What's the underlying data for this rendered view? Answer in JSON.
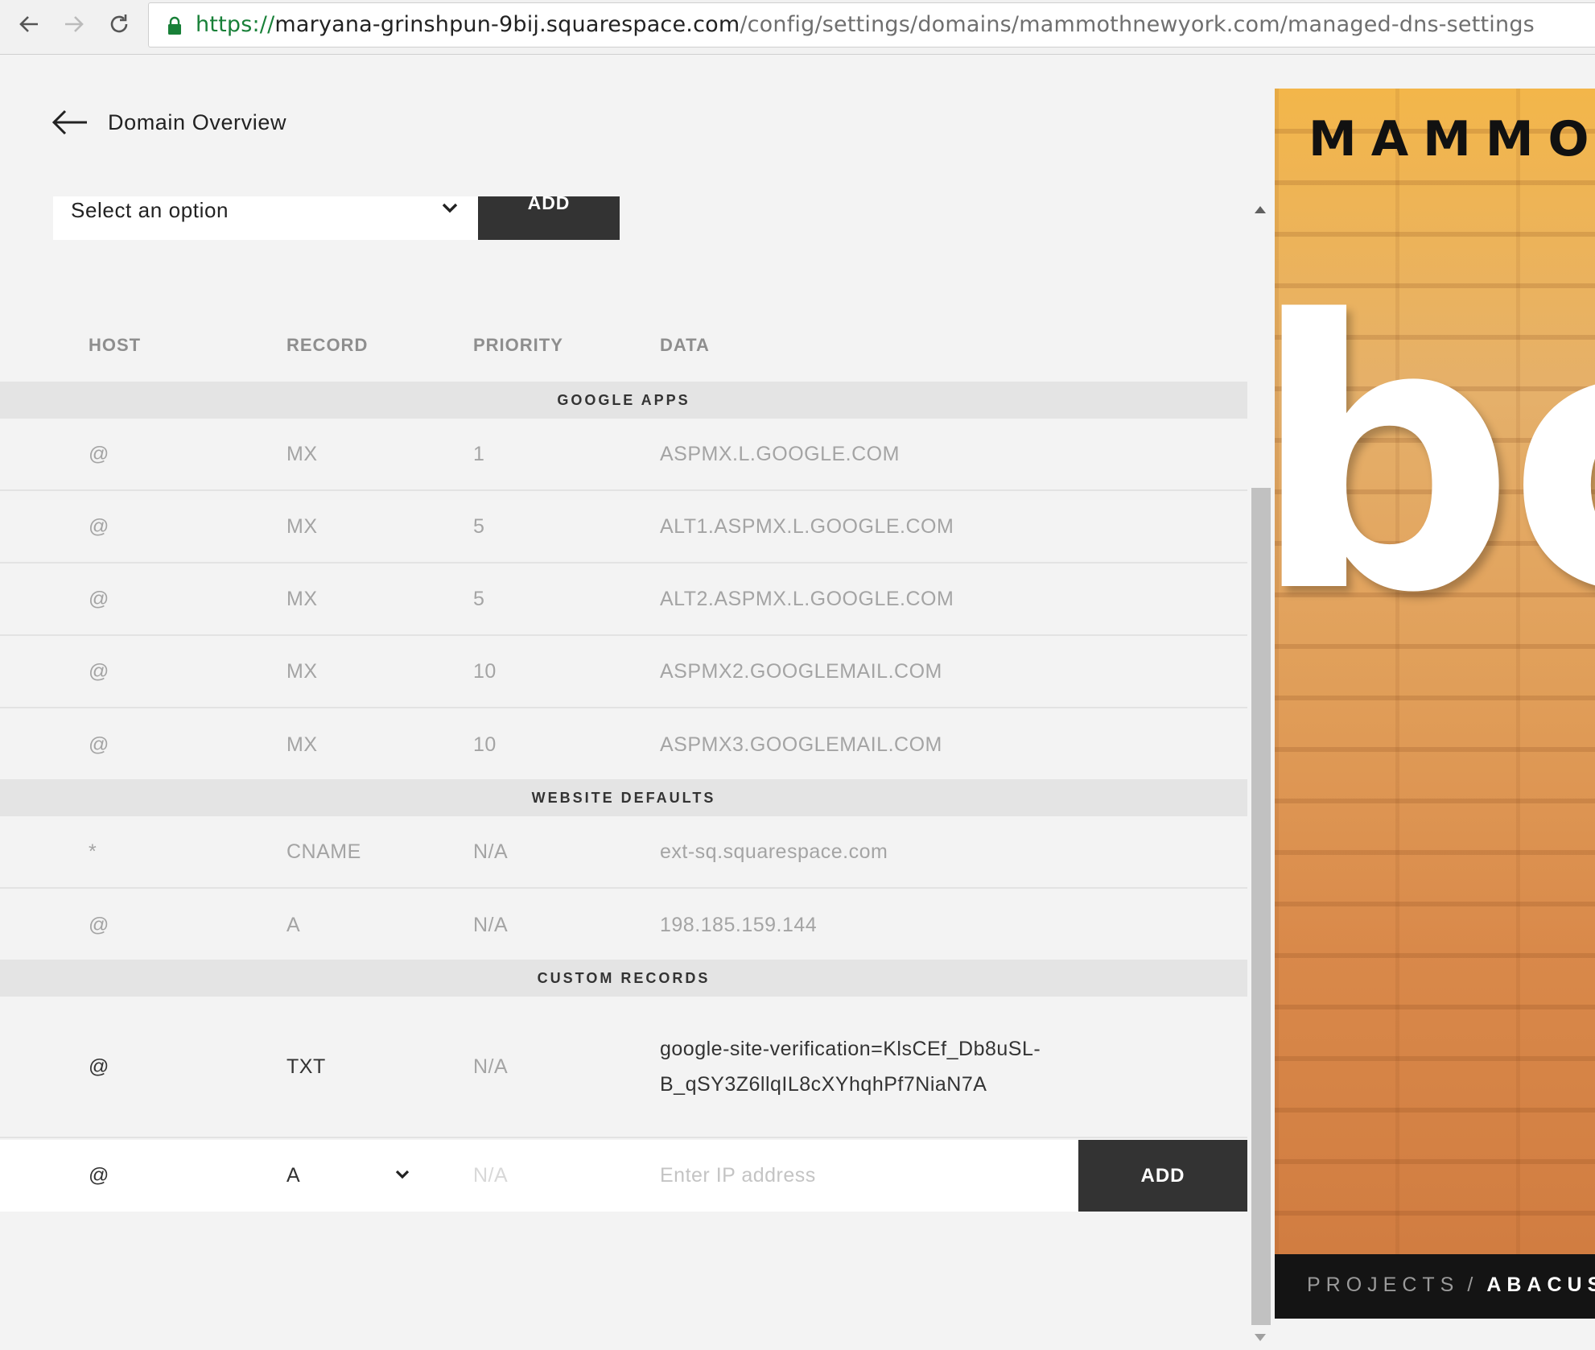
{
  "browser": {
    "url_scheme": "https://",
    "url_host": "maryana-grinshpun-9bij.squarespace.com",
    "url_path": "/config/settings/domains/mammothnewyork.com/managed-dns-settings"
  },
  "header": {
    "back_label": "Domain Overview"
  },
  "preset": {
    "select_value": "Select an option",
    "add_label": "ADD"
  },
  "columns": {
    "host": "HOST",
    "record": "RECORD",
    "priority": "PRIORITY",
    "data": "DATA"
  },
  "sections": {
    "google_apps": {
      "title": "GOOGLE APPS",
      "rows": [
        {
          "host": "@",
          "record": "MX",
          "priority": "1",
          "data": "ASPMX.L.GOOGLE.COM"
        },
        {
          "host": "@",
          "record": "MX",
          "priority": "5",
          "data": "ALT1.ASPMX.L.GOOGLE.COM"
        },
        {
          "host": "@",
          "record": "MX",
          "priority": "5",
          "data": "ALT2.ASPMX.L.GOOGLE.COM"
        },
        {
          "host": "@",
          "record": "MX",
          "priority": "10",
          "data": "ASPMX2.GOOGLEMAIL.COM"
        },
        {
          "host": "@",
          "record": "MX",
          "priority": "10",
          "data": "ASPMX3.GOOGLEMAIL.COM"
        }
      ]
    },
    "website_defaults": {
      "title": "WEBSITE DEFAULTS",
      "rows": [
        {
          "host": "*",
          "record": "CNAME",
          "priority": "N/A",
          "data": "ext-sq.squarespace.com"
        },
        {
          "host": "@",
          "record": "A",
          "priority": "N/A",
          "data": "198.185.159.144"
        }
      ]
    },
    "custom_records": {
      "title": "CUSTOM RECORDS",
      "rows": [
        {
          "host": "@",
          "record": "TXT",
          "priority": "N/A",
          "data": "google-site-verification=KlsCEf_Db8uSL-B_qSY3Z6llqIL8cXYhqhPf7NiaN7A"
        }
      ]
    }
  },
  "new_record": {
    "host": "@",
    "record": "A",
    "priority": "N/A",
    "data_placeholder": "Enter IP address",
    "add_label": "ADD"
  },
  "preview": {
    "brand": "MAMMOT",
    "big_text": "bc",
    "breadcrumb_parent": "PROJECTS",
    "breadcrumb_sep": "/",
    "breadcrumb_current": "ABACUS"
  },
  "colors": {
    "button_dark": "#333333",
    "url_secure": "#188038",
    "muted_text": "#a4a4a4"
  }
}
